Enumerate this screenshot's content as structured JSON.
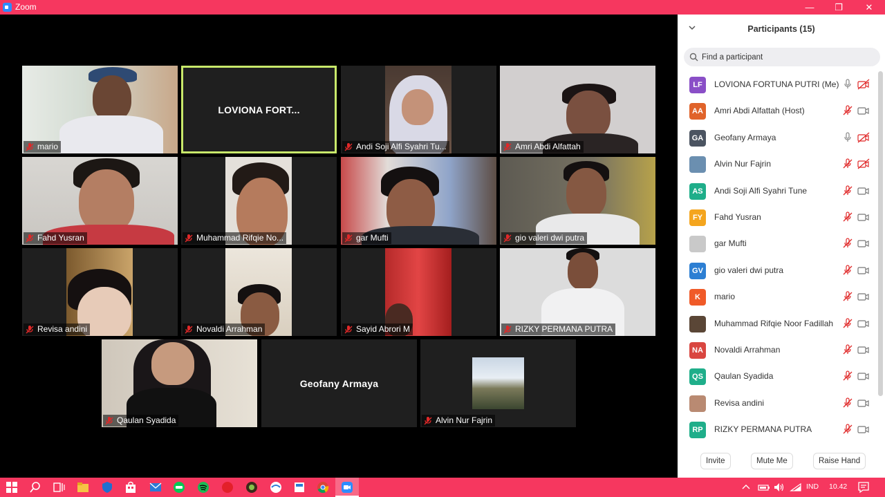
{
  "window": {
    "title": "Zoom",
    "accent": "#f6375f",
    "controls": {
      "minimize": "—",
      "restore": "❐",
      "close": "✕"
    }
  },
  "gallery": {
    "tiles": [
      {
        "name": "mario",
        "type": "video"
      },
      {
        "name": "LOVIONA FORT...",
        "type": "text",
        "active": true
      },
      {
        "name": "Andi Soji Alfi Syahri Tu...",
        "type": "video"
      },
      {
        "name": "Amri Abdi Alfattah",
        "type": "video"
      },
      {
        "name": "Fahd Yusran",
        "type": "video"
      },
      {
        "name": "Muhammad Rifqie No...",
        "type": "video"
      },
      {
        "name": "gar Mufti",
        "type": "video"
      },
      {
        "name": "gio valeri dwi putra",
        "type": "video"
      },
      {
        "name": "Revisa andini",
        "type": "video"
      },
      {
        "name": "Novaldi Arrahman",
        "type": "video"
      },
      {
        "name": "Sayid Abrori M",
        "type": "video"
      },
      {
        "name": "RIZKY PERMANA PUTRA",
        "type": "video"
      },
      {
        "name": "Qaulan Syadida",
        "type": "video"
      },
      {
        "name": "Geofany Armaya",
        "type": "text"
      },
      {
        "name": "Alvin Nur Fajrin",
        "type": "video"
      }
    ]
  },
  "participants_panel": {
    "title": "Participants (15)",
    "search_placeholder": "Find a participant",
    "participants": [
      {
        "initials": "LF",
        "name": "LOVIONA FORTUNA PUTRI (Me)",
        "color": "#8a4fc7",
        "mic": "on",
        "video": "off"
      },
      {
        "initials": "AA",
        "name": "Amri Abdi Alfattah (Host)",
        "color": "#e0632a",
        "mic": "muted",
        "video": "on"
      },
      {
        "initials": "GA",
        "name": "Geofany Armaya",
        "color": "#4b5461",
        "mic": "on",
        "video": "off"
      },
      {
        "initials": "",
        "name": "Alvin Nur Fajrin",
        "color": "#6b8fb0",
        "mic": "muted",
        "video": "off",
        "photo": true
      },
      {
        "initials": "AS",
        "name": "Andi Soji Alfi Syahri Tune",
        "color": "#1fae8a",
        "mic": "muted",
        "video": "on"
      },
      {
        "initials": "FY",
        "name": "Fahd Yusran",
        "color": "#f4a51e",
        "mic": "muted",
        "video": "on"
      },
      {
        "initials": "",
        "name": "gar Mufti",
        "color": "#c9c9c9",
        "mic": "muted",
        "video": "on",
        "photo": true
      },
      {
        "initials": "GV",
        "name": "gio valeri dwi putra",
        "color": "#2d7fd3",
        "mic": "muted",
        "video": "on"
      },
      {
        "initials": "K",
        "name": "mario",
        "color": "#f05a28",
        "mic": "muted",
        "video": "on"
      },
      {
        "initials": "",
        "name": "Muhammad Rifqie Noor Fadillah",
        "color": "#5a4636",
        "mic": "muted",
        "video": "on",
        "photo": true
      },
      {
        "initials": "NA",
        "name": "Novaldi Arrahman",
        "color": "#d94640",
        "mic": "muted",
        "video": "on"
      },
      {
        "initials": "QS",
        "name": "Qaulan Syadida",
        "color": "#1fae8a",
        "mic": "muted",
        "video": "on"
      },
      {
        "initials": "",
        "name": "Revisa andini",
        "color": "#b98a72",
        "mic": "muted",
        "video": "on",
        "photo": true
      },
      {
        "initials": "RP",
        "name": "RIZKY PERMANA PUTRA",
        "color": "#1fae8a",
        "mic": "muted",
        "video": "on"
      }
    ],
    "buttons": {
      "invite": "Invite",
      "mute_me": "Mute Me",
      "raise_hand": "Raise Hand"
    }
  },
  "taskbar": {
    "language": "IND",
    "time": "10.42"
  }
}
